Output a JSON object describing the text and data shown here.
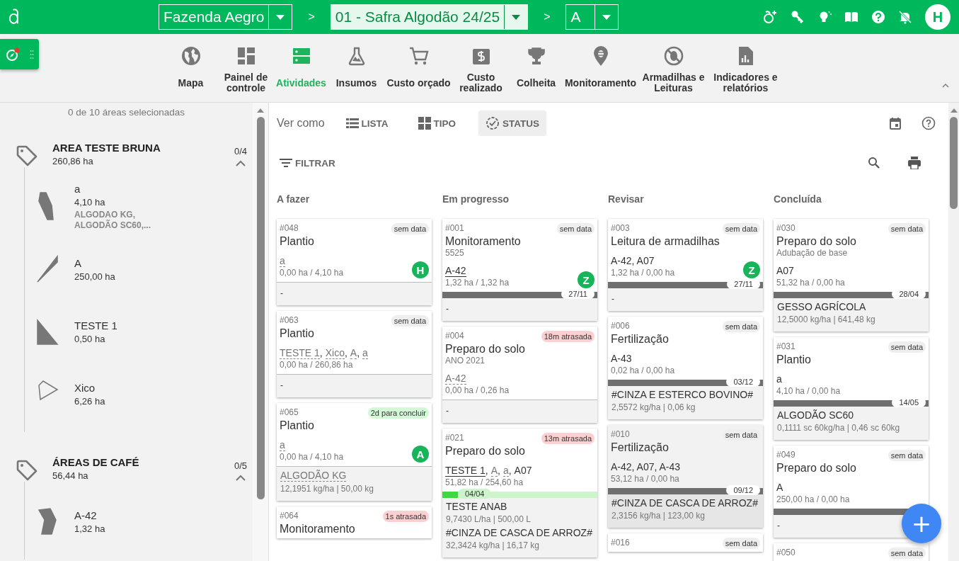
{
  "header": {
    "farm": "Fazenda Aegro",
    "season": "01 - Safra Algodão 24/25",
    "plot": "A",
    "separators": [
      ">",
      ">"
    ],
    "user_initial": "H"
  },
  "nav": {
    "items": [
      {
        "label": "Mapa",
        "selected": false
      },
      {
        "label": "Painel de controle",
        "selected": false
      },
      {
        "label": "Atividades",
        "selected": true
      },
      {
        "label": "Insumos",
        "selected": false
      },
      {
        "label": "Custo orçado",
        "selected": false
      },
      {
        "label": "Custo realizado",
        "selected": false
      },
      {
        "label": "Colheita",
        "selected": false
      },
      {
        "label": "Monitoramento",
        "selected": false
      },
      {
        "label": "Armadilhas e Leituras",
        "selected": false
      },
      {
        "label": "Indicadores e relatórios",
        "selected": false
      }
    ]
  },
  "sidebar": {
    "summary": "0 de 10 áreas selecionadas",
    "groups": [
      {
        "name": "AREA TESTE BRUNA",
        "area": "260,86 ha",
        "count": "0/4",
        "expanded": true,
        "items": [
          {
            "name": "a",
            "area": "4,10 ha",
            "crops": "ALGODAO KG, ALGODÃO SC60,..."
          },
          {
            "name": "A",
            "area": "250,00 ha"
          },
          {
            "name": "TESTE 1",
            "area": "0,50 ha"
          },
          {
            "name": "Xico",
            "area": "6,26 ha"
          }
        ]
      },
      {
        "name": "ÁREAS DE CAFÉ",
        "area": "56,44 ha",
        "count": "0/5",
        "expanded": true,
        "items": [
          {
            "name": "A-42",
            "area": "1,32 ha"
          }
        ]
      }
    ]
  },
  "toolbar": {
    "view_label": "Ver como",
    "views": [
      {
        "label": "LISTA",
        "selected": false
      },
      {
        "label": "TIPO",
        "selected": false
      },
      {
        "label": "STATUS",
        "selected": true
      }
    ],
    "filter": "FILTRAR"
  },
  "board": {
    "columns": [
      {
        "title": "A fazer",
        "cards": [
          {
            "id": "#048",
            "badge": {
              "text": "sem data",
              "kind": "none"
            },
            "title": "Plantio",
            "areas": [
              {
                "name": "a",
                "linked": false,
                "dashed": true
              }
            ],
            "hectares": "0,00 ha / 4,10 ha",
            "avatar": "H",
            "empty": "-"
          },
          {
            "id": "#063",
            "badge": {
              "text": "sem data",
              "kind": "none"
            },
            "title": "Plantio",
            "areas": [
              {
                "name": "TESTE 1",
                "sep": ",",
                "linked": false,
                "dashed": true
              },
              {
                "name": "Xico",
                "sep": ",",
                "linked": false,
                "dashed": true
              },
              {
                "name": "A",
                "sep": ",",
                "linked": false,
                "dashed": true
              },
              {
                "name": "a",
                "linked": false,
                "dashed": true
              }
            ],
            "hectares": "0,00 ha / 260,86 ha",
            "empty": "-"
          },
          {
            "id": "#065",
            "badge": {
              "text": "2d para concluir",
              "kind": "due"
            },
            "title": "Plantio",
            "areas": [
              {
                "name": "a",
                "linked": false,
                "dashed": true
              }
            ],
            "hectares": "0,00 ha / 4,10 ha",
            "avatar": "A",
            "inputs": [
              {
                "name": "ALGODÃO KG",
                "dashed": true,
                "amount": "12,1951 kg/ha | 50,00 kg"
              }
            ]
          },
          {
            "id": "#064",
            "badge": {
              "text": "1s atrasada",
              "kind": "late"
            },
            "title": "Monitoramento"
          }
        ]
      },
      {
        "title": "Em progresso",
        "cards": [
          {
            "id": "#001",
            "badge": {
              "text": "sem data",
              "kind": "none"
            },
            "title": "Monitoramento",
            "subtitle": "5525",
            "areas": [
              {
                "name": "A-42",
                "linked": true,
                "dashed": false
              }
            ],
            "hectares": "1,32 ha / 1,32 ha",
            "avatar": "Z",
            "progress": {
              "level": 1,
              "done": true,
              "date": "27/11"
            },
            "empty": "-"
          },
          {
            "id": "#004",
            "badge": {
              "text": "18m atrasada",
              "kind": "late"
            },
            "title": "Preparo do solo",
            "subtitle": "ANO 2021",
            "areas": [
              {
                "name": "A-42",
                "linked": false,
                "dashed": true
              }
            ],
            "hectares": "0,00 ha / 0,26 ha",
            "empty": "-"
          },
          {
            "id": "#021",
            "badge": {
              "text": "13m atrasada",
              "kind": "late"
            },
            "title": "Preparo do solo",
            "areas": [
              {
                "name": "TESTE 1",
                "sep": ",",
                "linked": true,
                "dashed": false
              },
              {
                "name": "A",
                "sep": ",",
                "linked": false,
                "dashed": true
              },
              {
                "name": "a",
                "sep": ",",
                "linked": false,
                "dashed": true
              },
              {
                "name": "A07",
                "linked": false,
                "dashed": false
              }
            ],
            "hectares": "51,82 ha / 254,60 ha",
            "progress": {
              "level": 0.1,
              "done": false,
              "date": "04/04"
            },
            "inputs": [
              {
                "name": "TESTE ANAB",
                "dashed": false,
                "amount": "9,7430 L/ha | 500,00 L"
              },
              {
                "name": "#CINZA DE CASCA DE ARROZ#",
                "dashed": false,
                "amount": "32,3424 kg/ha | 16,17 kg"
              }
            ]
          }
        ]
      },
      {
        "title": "Revisar",
        "cards": [
          {
            "id": "#003",
            "badge": {
              "text": "sem data",
              "kind": "none"
            },
            "title": "Leitura de armadilhas",
            "areas": [
              {
                "name": "A-42, A07",
                "linked": false,
                "dashed": false
              }
            ],
            "hectares": "1,32 ha / 0,00 ha",
            "avatar": "Z",
            "progress": {
              "level": 1,
              "done": true,
              "date": "27/11"
            },
            "empty": "-"
          },
          {
            "id": "#006",
            "badge": {
              "text": "sem data",
              "kind": "none"
            },
            "title": "Fertilização",
            "areas": [
              {
                "name": "A-43",
                "linked": false,
                "dashed": false
              }
            ],
            "hectares": "0,02 ha / 0,00 ha",
            "progress": {
              "level": 1,
              "done": true,
              "date": "03/12"
            },
            "inputs": [
              {
                "name": "#CINZA E ESTERCO BOVINO#",
                "dashed": false,
                "amount": "2,5572 kg/ha | 0,06 kg"
              }
            ]
          },
          {
            "id": "#010",
            "highlighted": true,
            "badge": {
              "text": "sem data",
              "kind": "none"
            },
            "title": "Fertilização",
            "areas": [
              {
                "name": "A-42, A07, A-43",
                "linked": false,
                "dashed": false
              }
            ],
            "hectares": "53,12 ha / 0,00 ha",
            "progress": {
              "level": 1,
              "done": true,
              "date": "09/12"
            },
            "inputs": [
              {
                "name": "#CINZA DE CASCA DE ARROZ#",
                "dashed": false,
                "amount": "2,3156 kg/ha | 123,00 kg"
              }
            ]
          },
          {
            "id": "#016",
            "badge": {
              "text": "sem data",
              "kind": "none"
            }
          }
        ]
      },
      {
        "title": "Concluída",
        "cards": [
          {
            "id": "#030",
            "badge": {
              "text": "sem data",
              "kind": "none"
            },
            "title": "Preparo do solo",
            "subtitle": "Adubação de base",
            "areas": [
              {
                "name": "A07",
                "linked": false,
                "dashed": false
              }
            ],
            "hectares": "51,32 ha / 0,00 ha",
            "progress": {
              "level": 1,
              "done": true,
              "date": "28/04"
            },
            "inputs": [
              {
                "name": "GESSO AGRÍCOLA",
                "dashed": false,
                "amount": "12,5000 kg/ha | 641,48 kg"
              }
            ]
          },
          {
            "id": "#031",
            "badge": {
              "text": "sem data",
              "kind": "none"
            },
            "title": "Plantio",
            "areas": [
              {
                "name": "a",
                "linked": false,
                "dashed": false
              }
            ],
            "hectares": "4,10 ha / 0,00 ha",
            "progress": {
              "level": 1,
              "done": true,
              "date": "14/05"
            },
            "inputs": [
              {
                "name": "ALGODÃO SC60",
                "dashed": false,
                "amount": "0,1111 sc 60kg/ha | 0,46 sc 60kg"
              }
            ]
          },
          {
            "id": "#049",
            "badge": {
              "text": "sem data",
              "kind": "none"
            },
            "title": "Preparo do solo",
            "areas": [
              {
                "name": "A",
                "linked": false,
                "dashed": false
              }
            ],
            "hectares": "250,00 ha / 0,00 ha",
            "progress": {
              "level": 1,
              "done": true
            },
            "empty": "-"
          },
          {
            "id": "#050",
            "badge": {
              "text": "sem data",
              "kind": "none"
            }
          }
        ]
      }
    ]
  },
  "fab": "+"
}
